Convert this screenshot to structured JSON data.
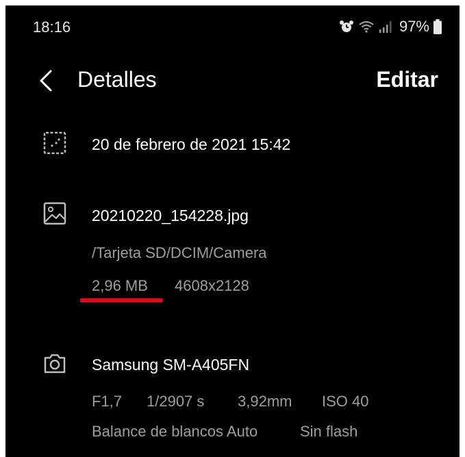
{
  "status_bar": {
    "time": "18:16",
    "battery_percent": "97%",
    "icons": [
      "alarm-icon",
      "wifi-icon",
      "signal-icon",
      "battery-icon"
    ]
  },
  "app_bar": {
    "back_icon": "chevron-left-icon",
    "title": "Detalles",
    "edit_label": "Editar"
  },
  "date_section": {
    "icon": "calendar-icon",
    "datetime": "20 de febrero de 2021 15:42"
  },
  "file_section": {
    "icon": "image-icon",
    "file_name": "20210220_154228.jpg",
    "path": "/Tarjeta SD/DCIM/Camera",
    "size": "2,96 MB",
    "resolution": "4608x2128"
  },
  "camera_section": {
    "icon": "camera-icon",
    "model": "Samsung SM-A405FN",
    "aperture": "F1,7",
    "shutter": "1/2907 s",
    "focal_length": "3,92mm",
    "iso": "ISO 40",
    "white_balance": "Balance de blancos Auto",
    "flash": "Sin flash"
  },
  "colors": {
    "background": "#000000",
    "primary_text": "#ffffff",
    "secondary_text": "#9e9e9e",
    "highlight": "#e30613"
  }
}
